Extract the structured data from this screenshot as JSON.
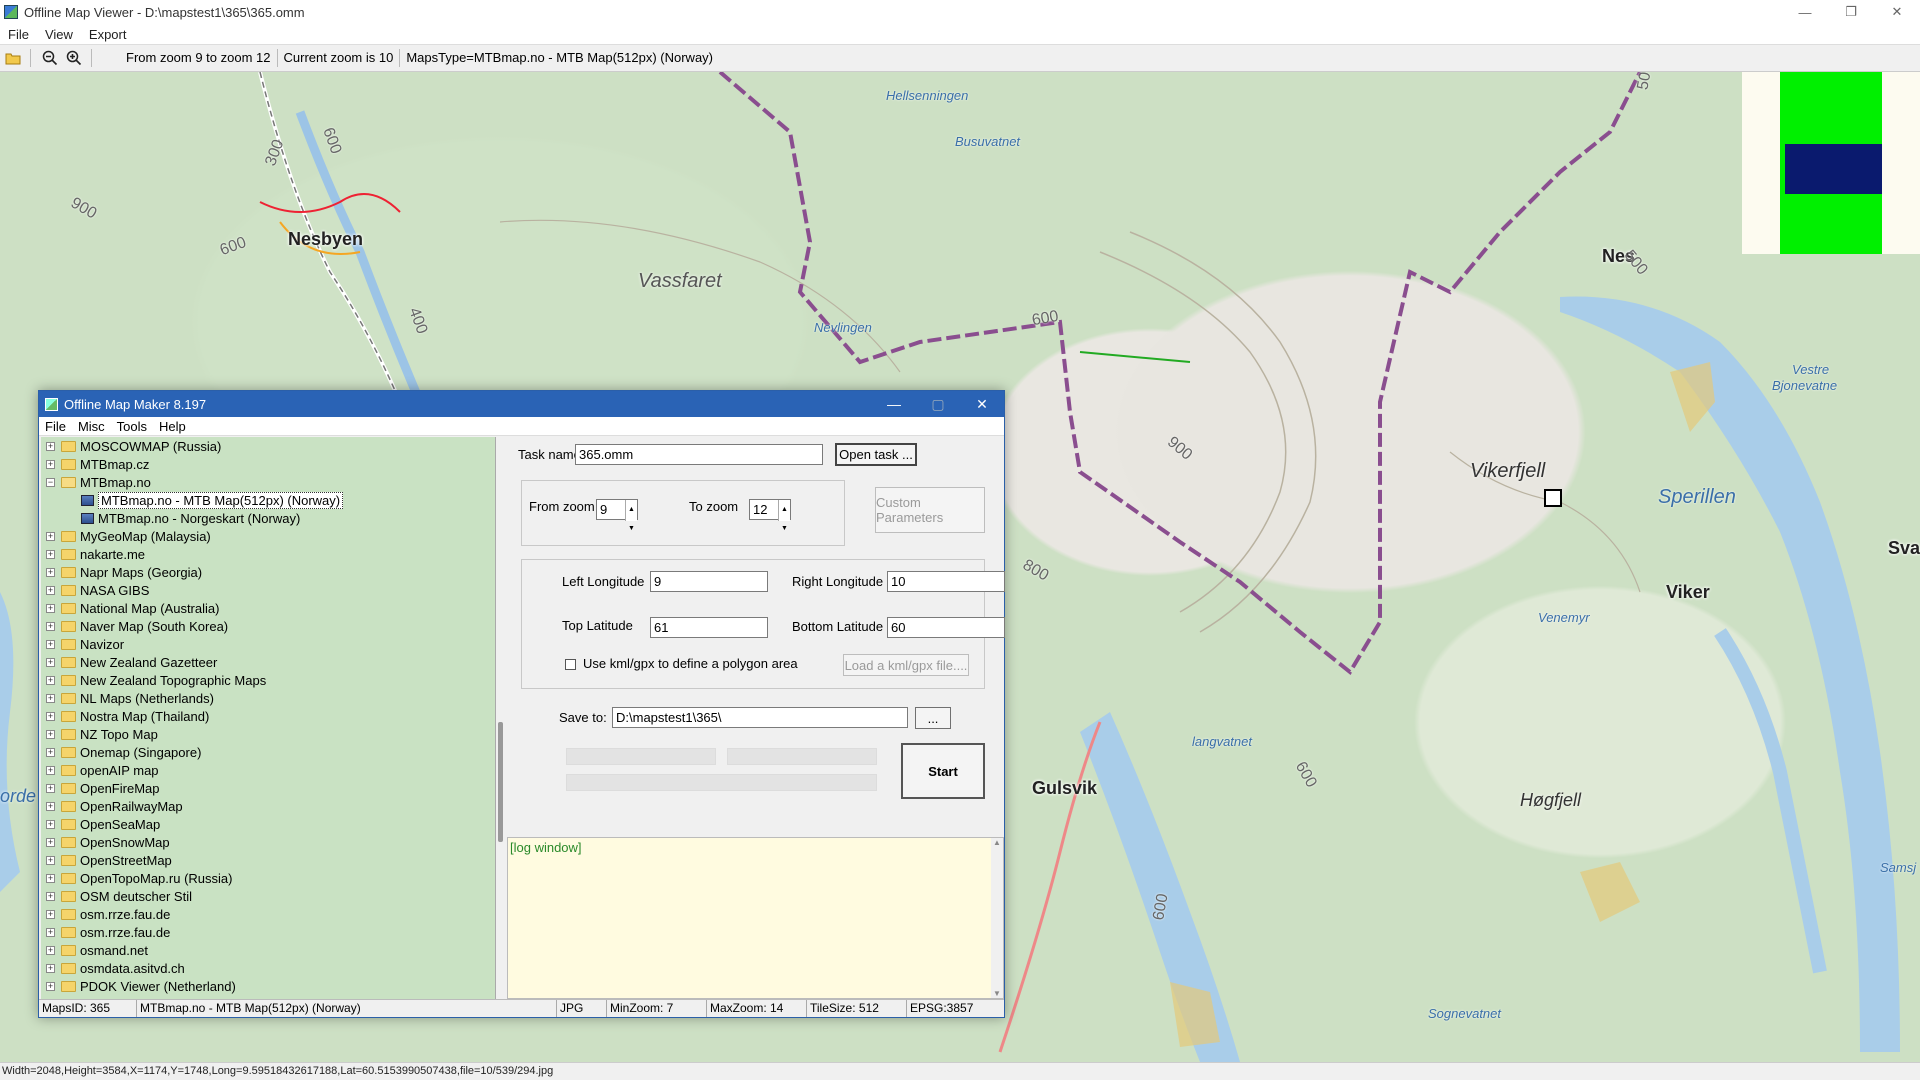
{
  "window": {
    "title": "Offline Map Viewer - D:\\mapstest1\\365\\365.omm",
    "min": "—",
    "max": "❐",
    "close": "✕"
  },
  "menu": [
    "File",
    "View",
    "Export"
  ],
  "toolbar": {
    "zoom_range": "From zoom 9 to zoom 12",
    "current_zoom": "Current zoom is 10",
    "maps_type": "MapsType=MTBmap.no - MTB Map(512px) (Norway)"
  },
  "map_labels": {
    "nesbyen": "Nesbyen",
    "vassfaret": "Vassfaret",
    "nes": "Nes",
    "vikerfjell": "Vikerfjell",
    "sperillen": "Sperillen",
    "viker": "Viker",
    "gulsvik": "Gulsvik",
    "hogfjell": "Høgfjell",
    "hellsenningen": "Hellsenningen",
    "busuvatnet": "Busuvatnet",
    "nevlingen": "Nevlingen",
    "vestre_bjonevatne_1": "Vestre",
    "vestre_bjonevatne_2": "Bjonevatne",
    "venemyr": "Venemyr",
    "langvatnet": "langvatnet",
    "sognevatnet": "Sognevatnet",
    "samsj": "Samsj",
    "sva": "Sva",
    "orde": "orde",
    "e600a": "600",
    "e300": "300",
    "e900a": "900",
    "e600b": "600",
    "e400": "400",
    "e600c": "600",
    "e900b": "900",
    "e800": "800",
    "e50": "50",
    "e500": "500",
    "e600d": "600",
    "e600e": "600"
  },
  "statusbar": "Width=2048,Height=3584,X=1174,Y=1748,Long=9.59518432617188,Lat=60.5153990507438,file=10/539/294.jpg",
  "dialog": {
    "title": "Offline Map Maker 8.197",
    "menu": [
      "File",
      "Misc",
      "Tools",
      "Help"
    ],
    "tree": [
      {
        "label": "MOSCOWMAP (Russia)",
        "expanded": false
      },
      {
        "label": "MTBmap.cz",
        "expanded": false
      },
      {
        "label": "MTBmap.no",
        "expanded": true,
        "children": [
          {
            "label": "MTBmap.no - MTB Map(512px) (Norway)",
            "selected": true
          },
          {
            "label": "MTBmap.no - Norgeskart (Norway)",
            "selected": false
          }
        ]
      },
      {
        "label": "MyGeoMap (Malaysia)",
        "expanded": false
      },
      {
        "label": "nakarte.me",
        "expanded": false
      },
      {
        "label": "Napr Maps (Georgia)",
        "expanded": false
      },
      {
        "label": "NASA GIBS",
        "expanded": false
      },
      {
        "label": "National Map (Australia)",
        "expanded": false
      },
      {
        "label": "Naver Map (South Korea)",
        "expanded": false
      },
      {
        "label": "Navizor",
        "expanded": false
      },
      {
        "label": "New Zealand Gazetteer",
        "expanded": false
      },
      {
        "label": "New Zealand Topographic Maps",
        "expanded": false
      },
      {
        "label": "NL Maps (Netherlands)",
        "expanded": false
      },
      {
        "label": "Nostra Map (Thailand)",
        "expanded": false
      },
      {
        "label": "NZ Topo Map",
        "expanded": false
      },
      {
        "label": "Onemap (Singapore)",
        "expanded": false
      },
      {
        "label": "openAIP map",
        "expanded": false
      },
      {
        "label": "OpenFireMap",
        "expanded": false
      },
      {
        "label": "OpenRailwayMap",
        "expanded": false
      },
      {
        "label": "OpenSeaMap",
        "expanded": false
      },
      {
        "label": "OpenSnowMap",
        "expanded": false
      },
      {
        "label": "OpenStreetMap",
        "expanded": false
      },
      {
        "label": "OpenTopoMap.ru (Russia)",
        "expanded": false
      },
      {
        "label": "OSM deutscher Stil",
        "expanded": false
      },
      {
        "label": "osm.rrze.fau.de",
        "expanded": false
      },
      {
        "label": "osm.rrze.fau.de",
        "expanded": false
      },
      {
        "label": "osmand.net",
        "expanded": false
      },
      {
        "label": "osmdata.asitvd.ch",
        "expanded": false
      },
      {
        "label": "PDOK Viewer (Netherland)",
        "expanded": false
      }
    ],
    "task_name_label": "Task name",
    "task_name_value": "365.omm",
    "open_task": "Open task ...",
    "from_zoom_label": "From zoom",
    "from_zoom_value": "9",
    "to_zoom_label": "To zoom",
    "to_zoom_value": "12",
    "custom_params": "Custom Parameters",
    "left_lon_label": "Left Longitude",
    "left_lon_value": "9",
    "right_lon_label": "Right Longitude",
    "right_lon_value": "10",
    "top_lat_label": "Top Latitude",
    "top_lat_value": "61",
    "bottom_lat_label": "Bottom Latitude",
    "bottom_lat_value": "60",
    "kml_label": "Use kml/gpx to define a polygon area",
    "load_kml": "Load a kml/gpx file....",
    "save_to_label": "Save to:",
    "save_to_value": "D:\\mapstest1\\365\\",
    "browse": "...",
    "start": "Start",
    "log": "[log window]",
    "status": {
      "maps_id": "MapsID: 365",
      "maps_name": "MTBmap.no - MTB Map(512px) (Norway)",
      "format": "JPG",
      "min_zoom": "MinZoom: 7",
      "max_zoom": "MaxZoom: 14",
      "tile_size": "TileSize: 512",
      "epsg": "EPSG:3857"
    }
  }
}
